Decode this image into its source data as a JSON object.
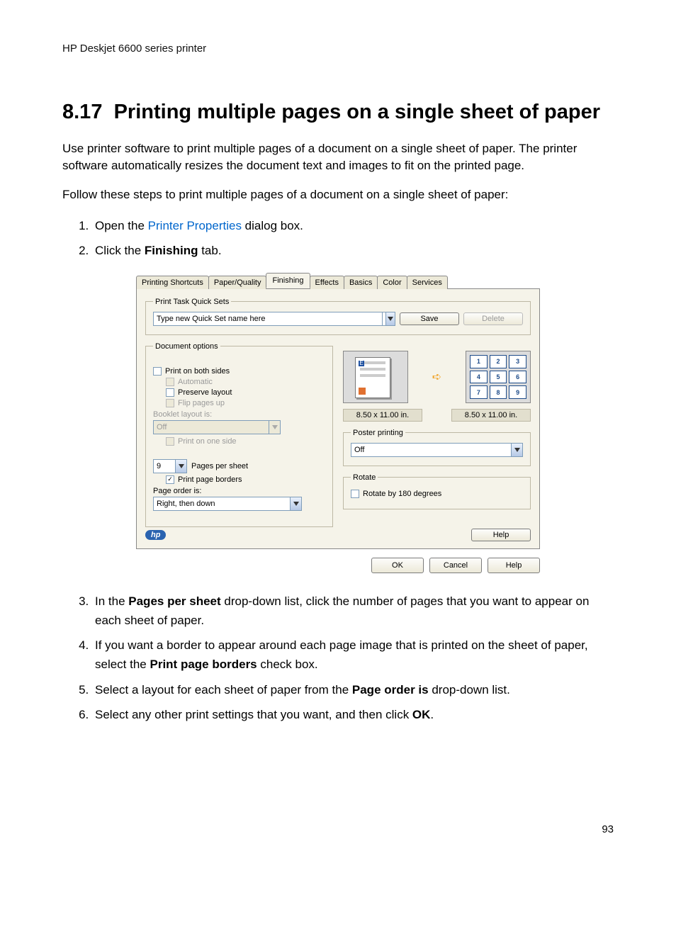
{
  "header": {
    "product": "HP Deskjet 6600 series printer"
  },
  "section": {
    "number": "8.17",
    "title": "Printing multiple pages on a single sheet of paper",
    "intro1": "Use printer software to print multiple pages of a document on a single sheet of paper. The printer software automatically resizes the document text and images to fit on the printed page.",
    "intro2": "Follow these steps to print multiple pages of a document on a single sheet of paper:"
  },
  "steps": {
    "s1_a": "Open the ",
    "s1_link": "Printer Properties",
    "s1_b": " dialog box.",
    "s2_a": "Click the ",
    "s2_bold": "Finishing",
    "s2_b": " tab.",
    "s3_a": "In the ",
    "s3_bold": "Pages per sheet",
    "s3_b": " drop-down list, click the number of pages that you want to appear on each sheet of paper.",
    "s4_a": "If you want a border to appear around each page image that is printed on the sheet of paper, select the ",
    "s4_bold": "Print page borders",
    "s4_b": " check box.",
    "s5_a": "Select a layout for each sheet of paper from the ",
    "s5_bold": "Page order is",
    "s5_b": " drop-down list.",
    "s6_a": "Select any other print settings that you want, and then click ",
    "s6_bold": "OK",
    "s6_b": "."
  },
  "dialog": {
    "tabs": [
      "Printing Shortcuts",
      "Paper/Quality",
      "Finishing",
      "Effects",
      "Basics",
      "Color",
      "Services"
    ],
    "active_tab_index": 2,
    "quicksets": {
      "legend": "Print Task Quick Sets",
      "value": "Type new Quick Set name here",
      "save": "Save",
      "delete": "Delete"
    },
    "docopts": {
      "legend": "Document options",
      "print_both": "Print on both sides",
      "automatic": "Automatic",
      "preserve": "Preserve layout",
      "flip": "Flip pages up",
      "booklet_label": "Booklet layout is:",
      "booklet_value": "Off",
      "print_one_side": "Print on one side",
      "pages_per_sheet_value": "9",
      "pages_per_sheet_label": "Pages per sheet",
      "print_page_borders": "Print page borders",
      "page_order_label": "Page order is:",
      "page_order_value": "Right, then down"
    },
    "preview": {
      "dim_left": "8.50 x 11.00 in.",
      "dim_right": "8.50 x 11.00 in.",
      "cells": [
        "1",
        "2",
        "3",
        "4",
        "5",
        "6",
        "7",
        "8",
        "9"
      ]
    },
    "poster": {
      "legend": "Poster printing",
      "value": "Off"
    },
    "rotate": {
      "legend": "Rotate",
      "label": "Rotate by 180 degrees"
    },
    "help": "Help",
    "hp": "hp",
    "footer": {
      "ok": "OK",
      "cancel": "Cancel",
      "help": "Help"
    }
  },
  "page_number": "93"
}
